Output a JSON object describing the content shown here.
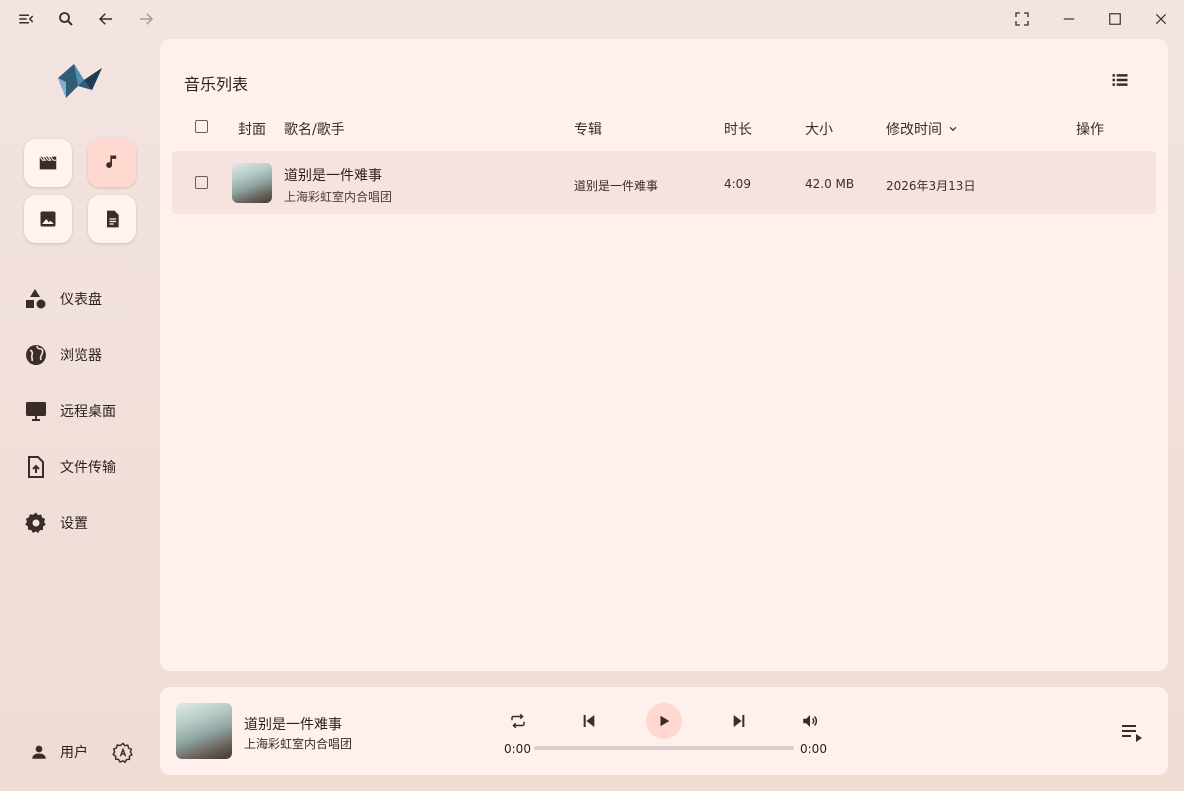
{
  "sidebar": {
    "nav": [
      {
        "icon": "shapes-icon",
        "label": "仪表盘"
      },
      {
        "icon": "globe-icon",
        "label": "浏览器"
      },
      {
        "icon": "monitor-icon",
        "label": "远程桌面"
      },
      {
        "icon": "file-upload-icon",
        "label": "文件传输"
      },
      {
        "icon": "gear-icon",
        "label": "设置"
      }
    ],
    "user_label": "用户"
  },
  "main": {
    "title": "音乐列表",
    "columns": {
      "cover": "封面",
      "title_artist": "歌名/歌手",
      "album": "专辑",
      "duration": "时长",
      "size": "大小",
      "modified": "修改时间",
      "actions": "操作"
    },
    "sort_column": "modified",
    "rows": [
      {
        "title": "道别是一件难事",
        "artist": "上海彩虹室内合唱团",
        "album": "道别是一件难事",
        "duration": "4:09",
        "size": "42.0 MB",
        "modified": "2026年3月13日"
      }
    ]
  },
  "player": {
    "title": "道别是一件难事",
    "artist": "上海彩虹室内合唱团",
    "current_time": "0:00",
    "total_time": "0:00",
    "progress": 0
  },
  "colors": {
    "accent": "#ffd9cf",
    "panel": "#fff0ed",
    "row_highlight": "#f6e3e0",
    "icon": "#3a2d29"
  }
}
